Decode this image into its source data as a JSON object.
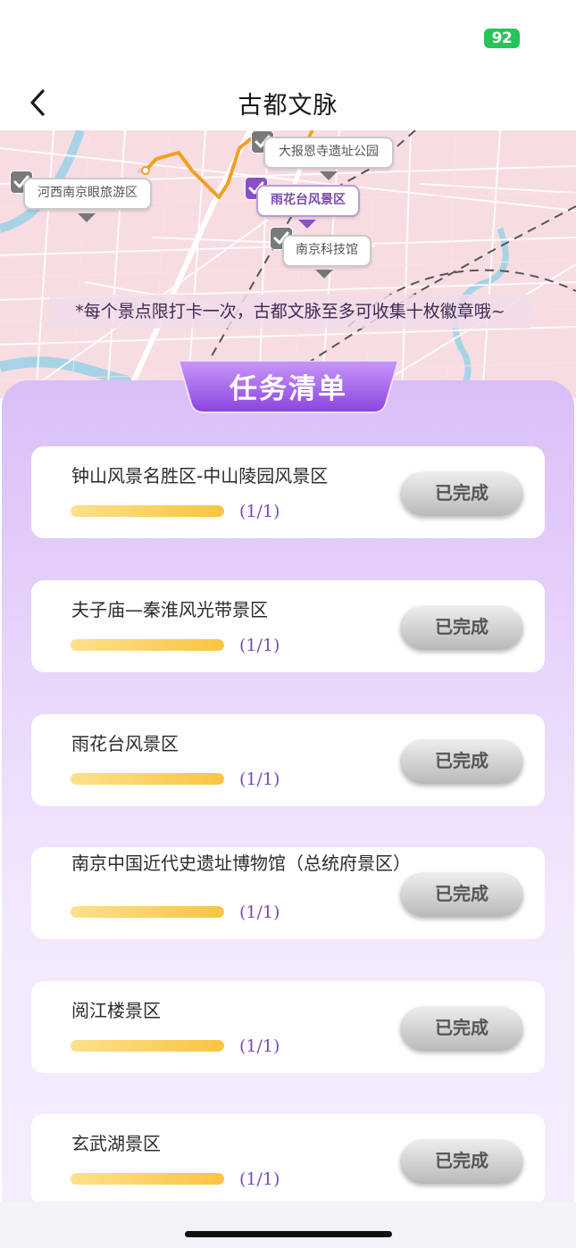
{
  "status_bar": {
    "battery": "92"
  },
  "nav": {
    "title": "古都文脉"
  },
  "map": {
    "spots": [
      {
        "label": "大报恩寺遗址公园",
        "checked": true,
        "active": false
      },
      {
        "label": "河西南京眼旅游区",
        "checked": true,
        "active": false
      },
      {
        "label": "雨花台风景区",
        "checked": true,
        "active": true
      },
      {
        "label": "南京科技馆",
        "checked": true,
        "active": false
      }
    ],
    "notice": "*每个景点限打卡一次，古都文脉至多可收集十枚徽章哦~"
  },
  "task_list": {
    "title": "任务清单",
    "tasks": [
      {
        "name": "钟山风景名胜区-中山陵园风景区",
        "progress_text": "(1/1)",
        "progress": 1.0,
        "button": "已完成"
      },
      {
        "name": "夫子庙—秦淮风光带景区",
        "progress_text": "(1/1)",
        "progress": 1.0,
        "button": "已完成"
      },
      {
        "name": "雨花台风景区",
        "progress_text": "(1/1)",
        "progress": 1.0,
        "button": "已完成"
      },
      {
        "name": "南京中国近代史遗址博物馆（总统府景区）",
        "progress_text": "(1/1)",
        "progress": 1.0,
        "button": "已完成"
      },
      {
        "name": "阅江楼景区",
        "progress_text": "(1/1)",
        "progress": 1.0,
        "button": "已完成"
      },
      {
        "name": "玄武湖景区",
        "progress_text": "(1/1)",
        "progress": 1.0,
        "button": "已完成"
      }
    ]
  },
  "colors": {
    "accent_purple": "#8a4fc6",
    "progress_gold": "#f9c440",
    "battery_green": "#27c459",
    "route_orange": "#f0a020"
  }
}
